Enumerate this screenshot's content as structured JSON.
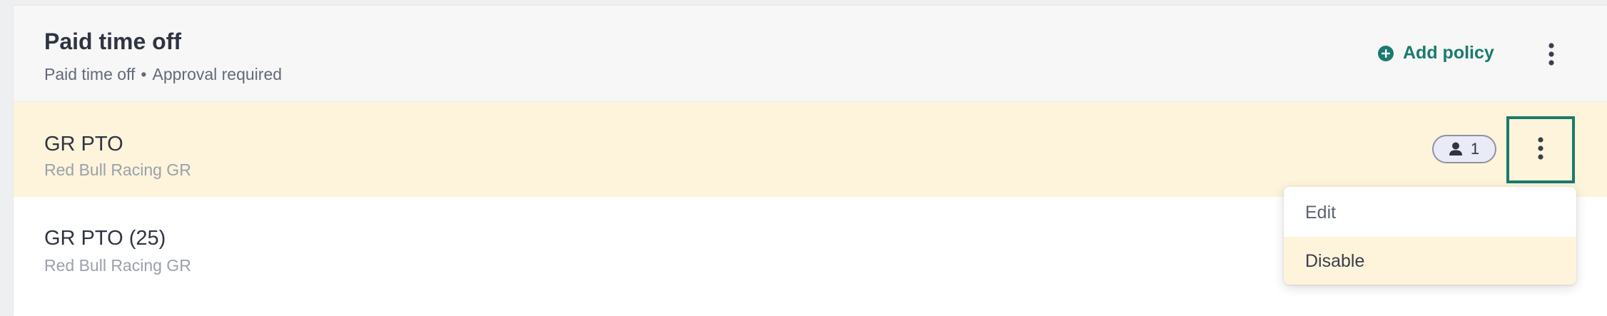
{
  "header": {
    "title": "Paid time off",
    "subtitle_type": "Paid time off",
    "subtitle_separator": "•",
    "subtitle_approval": "Approval required",
    "add_policy_label": "Add policy"
  },
  "policies": [
    {
      "name": "GR PTO",
      "organization": "Red Bull Racing GR",
      "assigned_count": "1",
      "highlighted": true
    },
    {
      "name": "GR PTO (25)",
      "organization": "Red Bull Racing GR",
      "highlighted": false
    }
  ],
  "context_menu": {
    "items": [
      {
        "label": "Edit"
      },
      {
        "label": "Disable"
      }
    ]
  },
  "colors": {
    "accent": "#1a7a6e",
    "row_highlight": "#fdf4db",
    "header_bg": "#f7f7f8",
    "badge_bg": "#e9ebf6"
  },
  "icons": {
    "add": "plus-circle-icon",
    "more": "more-vertical-icon",
    "person": "person-icon"
  }
}
